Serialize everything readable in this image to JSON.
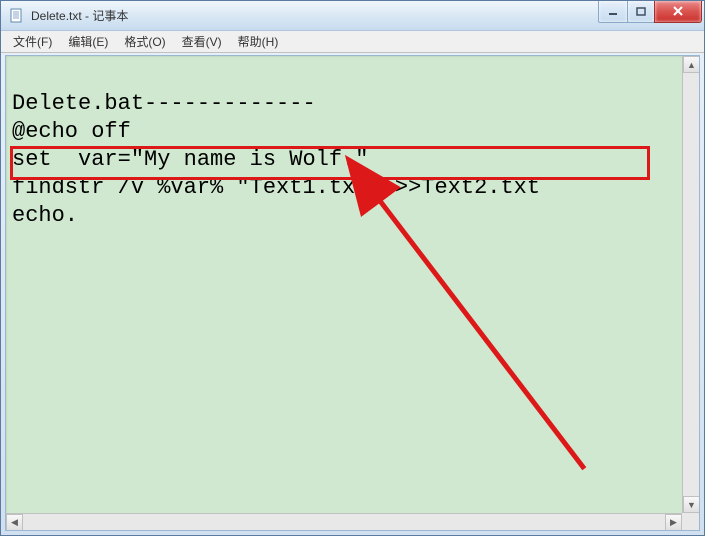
{
  "window": {
    "title": "Delete.txt - 记事本"
  },
  "menubar": {
    "items": [
      {
        "label": "文件(F)"
      },
      {
        "label": "编辑(E)"
      },
      {
        "label": "格式(O)"
      },
      {
        "label": "查看(V)"
      },
      {
        "label": "帮助(H)"
      }
    ]
  },
  "content": {
    "lines": [
      "Delete.bat-------------",
      "@echo off",
      "set  var=\"My name is Wolf.\"",
      "findstr /v %var% \"Text1.txt\" >>Text2.txt",
      "echo."
    ]
  },
  "annotation": {
    "highlight_line_index": 3,
    "arrow_color": "#dc1818"
  }
}
